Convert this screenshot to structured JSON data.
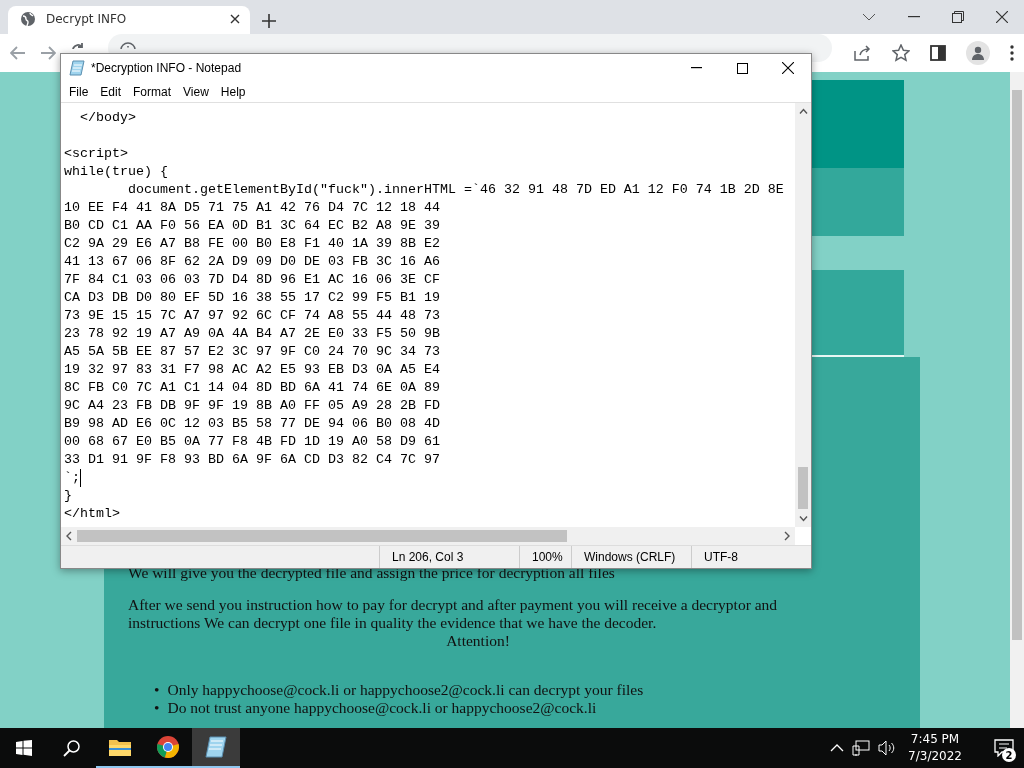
{
  "browser": {
    "tabs": [
      {
        "title": "Decrypt INFO",
        "selected": true
      }
    ]
  },
  "page": {
    "paragraphs": [
      "We will give you the decrypted file and assign the price for decryption all files",
      "After we send you instruction how to pay for decrypt and after payment you will receive a decryptor and instructions We can decrypt one file in quality the evidence that we have the decoder."
    ],
    "heading": "Attention!",
    "list": [
      {
        "marker": "•",
        "text": "Only happychoose@cock.li or happychoose2@cock.li can decrypt your files"
      },
      {
        "marker": "•",
        "text": "Do not trust anyone happychoose@cock.li or happychoose2@cock.li"
      }
    ]
  },
  "notepad": {
    "title": "*Decryption INFO - Notepad",
    "menu": [
      "File",
      "Edit",
      "Format",
      "View",
      "Help"
    ],
    "lines": [
      {
        "text": "  </body>",
        "blank_before": false,
        "caret": false
      },
      {
        "text": "<script>",
        "blank_before": true,
        "caret": false
      },
      {
        "text": "while(true) {",
        "blank_before": false,
        "caret": false
      },
      {
        "text": "        document.getElementById(\"fuck\").innerHTML =`46 32 91 48 7D ED A1 12 F0 74 1B 2D 8E",
        "blank_before": false,
        "caret": false
      },
      {
        "text": "10 EE F4 41 8A D5 71 75 A1 42 76 D4 7C 12 18 44",
        "blank_before": false,
        "caret": false
      },
      {
        "text": "B0 CD C1 AA F0 56 EA 0D B1 3C 64 EC B2 A8 9E 39",
        "blank_before": false,
        "caret": false
      },
      {
        "text": "C2 9A 29 E6 A7 B8 FE 00 B0 E8 F1 40 1A 39 8B E2",
        "blank_before": false,
        "caret": false
      },
      {
        "text": "41 13 67 06 8F 62 2A D9 09 D0 DE 03 FB 3C 16 A6",
        "blank_before": false,
        "caret": false
      },
      {
        "text": "7F 84 C1 03 06 03 7D D4 8D 96 E1 AC 16 06 3E CF",
        "blank_before": false,
        "caret": false
      },
      {
        "text": "CA D3 DB D0 80 EF 5D 16 38 55 17 C2 99 F5 B1 19",
        "blank_before": false,
        "caret": false
      },
      {
        "text": "73 9E 15 15 7C A7 97 92 6C CF 74 A8 55 44 48 73",
        "blank_before": false,
        "caret": false
      },
      {
        "text": "23 78 92 19 A7 A9 0A 4A B4 A7 2E E0 33 F5 50 9B",
        "blank_before": false,
        "caret": false
      },
      {
        "text": "A5 5A 5B EE 87 57 E2 3C 97 9F C0 24 70 9C 34 73",
        "blank_before": false,
        "caret": false
      },
      {
        "text": "19 32 97 83 31 F7 98 AC A2 E5 93 EB D3 0A A5 E4",
        "blank_before": false,
        "caret": false
      },
      {
        "text": "8C FB C0 7C A1 C1 14 04 8D BD 6A 41 74 6E 0A 89",
        "blank_before": false,
        "caret": false
      },
      {
        "text": "9C A4 23 FB DB 9F 9F 19 8B A0 FF 05 A9 28 2B FD",
        "blank_before": false,
        "caret": false
      },
      {
        "text": "B9 98 AD E6 0C 12 03 B5 58 77 DE 94 06 B0 08 4D",
        "blank_before": false,
        "caret": false
      },
      {
        "text": "00 68 67 E0 B5 0A 77 F8 4B FD 1D 19 A0 58 D9 61",
        "blank_before": false,
        "caret": false
      },
      {
        "text": "33 D1 91 9F F8 93 BD 6A 9F 6A CD D3 82 C4 7C 97",
        "blank_before": false,
        "caret": false
      },
      {
        "text": "`;",
        "blank_before": false,
        "caret": true
      },
      {
        "text": "}",
        "blank_before": false,
        "caret": false
      },
      {
        "text": "</html>",
        "blank_before": false,
        "caret": false
      }
    ],
    "status": {
      "position": "Ln 206, Col 3",
      "zoom": "100%",
      "line_endings": "Windows (CRLF)",
      "encoding": "UTF-8"
    }
  },
  "taskbar": {
    "apps": [
      {
        "kind": "explorer",
        "selected": false,
        "running": true
      },
      {
        "kind": "chrome",
        "selected": false,
        "running": true
      },
      {
        "kind": "notepad",
        "selected": true,
        "running": true
      }
    ],
    "time": "7:45 PM",
    "date": "7/3/2022",
    "notifications": "2"
  }
}
